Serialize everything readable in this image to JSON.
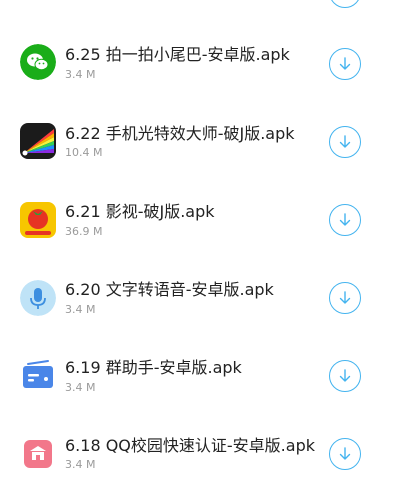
{
  "colors": {
    "accent": "#44b4ef",
    "title_text": "#222222",
    "size_text": "#9a9a9a"
  },
  "items": [
    {
      "title": "6.25 拍一拍小尾巴-安卓版.apk",
      "size": "3.4 M",
      "icon": "wechat-icon",
      "download": "download-icon"
    },
    {
      "title": "6.22 手机光特效大师-破J版.apk",
      "size": "10.4 M",
      "icon": "light-effect-app-icon",
      "download": "download-icon"
    },
    {
      "title": "6.21 影视-破J版.apk",
      "size": "36.9 M",
      "icon": "tomato-app-icon",
      "download": "download-icon"
    },
    {
      "title": "6.20 文字转语音-安卓版.apk",
      "size": "3.4 M",
      "icon": "microphone-icon",
      "download": "download-icon"
    },
    {
      "title": "6.19 群助手-安卓版.apk",
      "size": "3.4 M",
      "icon": "card-app-icon",
      "download": "download-icon"
    },
    {
      "title": "6.18 QQ校园快速认证-安卓版.apk",
      "size": "3.4 M",
      "icon": "campus-app-icon",
      "download": "download-icon"
    }
  ]
}
